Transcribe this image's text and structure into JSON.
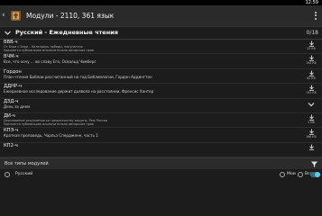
{
  "status": {
    "time": "12:59"
  },
  "appbar": {
    "title": "Модули - 2110, 361 язык"
  },
  "group": {
    "title": "Русский - Ежедневные чтения",
    "count": "0/18"
  },
  "rows": [
    {
      "name": "ВВВ-ч",
      "desc": "От Бэри к Бэри – Календарь победы, покупатель\nУдаляется публикацию исключительно авторские прав",
      "desc_small": true,
      "size": "23 КБ"
    },
    {
      "name": "ВЧМ-ч",
      "desc": "Все, что хочу ... во славу Его, Освальд Чамберс",
      "desc_small": false,
      "size": "194 КБ"
    },
    {
      "name": "Гордон",
      "desc": "План чтения Библии рассчитанный на год Библиологии, Гордон Аддингтон",
      "desc_small": false,
      "size": "62 КБ"
    },
    {
      "name": "ДДНР-ч",
      "desc": "Ежедневное исследование держит дьявола на расстоянии, Френсис Хантер",
      "desc_small": false,
      "size": "153 КБ"
    },
    {
      "name": "ДЗД-ч",
      "desc": "День за днем",
      "desc_small": false,
      "size": ""
    },
    {
      "name": "ДИ-ч",
      "desc": "Дерзновение искупления ко грешничеству защиты, Реж Россер\nУдаляется публикацию исключительно авторские прав",
      "desc_small": true,
      "size": "1 МБ"
    },
    {
      "name": "КПЭ-ч",
      "desc": "Краткая проповедь, Чарльз Спердженн, часть 1",
      "desc_small": false,
      "size": "166 КБ"
    },
    {
      "name": "КП2-ч",
      "desc": "",
      "desc_small": false,
      "size": ""
    }
  ],
  "filter": {
    "text": "Все типы модулей"
  },
  "bottom": {
    "language": "Русский",
    "mine": "Мои",
    "all": "Все"
  },
  "colors": {
    "accent": "#5fc9df",
    "background": "#1c1c1c"
  }
}
